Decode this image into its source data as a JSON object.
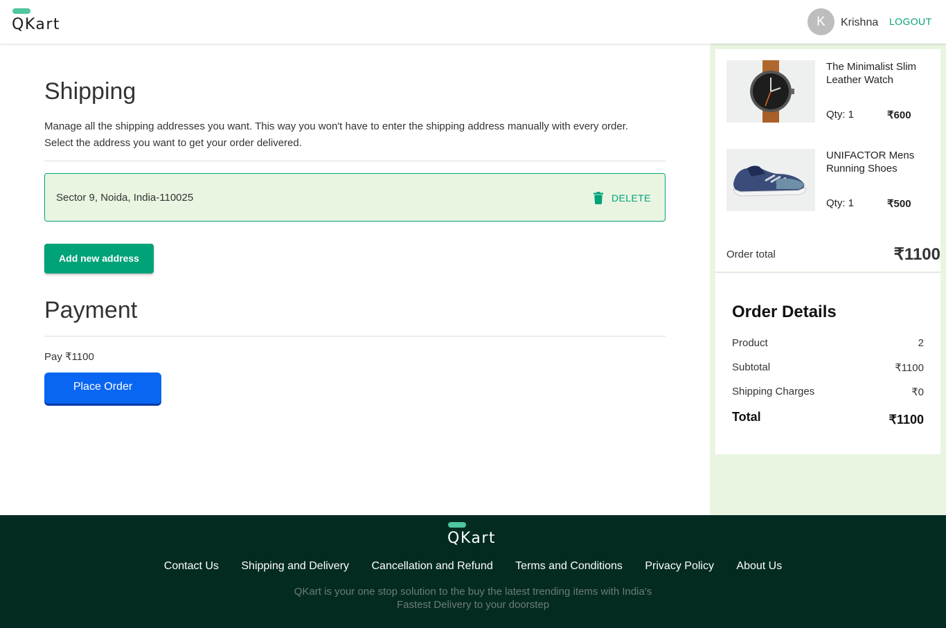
{
  "header": {
    "logo_text": "QKart",
    "avatar_letter": "K",
    "username": "Krishna",
    "logout_label": "LOGOUT"
  },
  "shipping": {
    "title": "Shipping",
    "description_line1": "Manage all the shipping addresses you want. This way you won't have to enter the shipping address manually with every order.",
    "description_line2": "Select the address you want to get your order delivered.",
    "addresses": [
      {
        "text": "Sector 9, Noida, India-110025",
        "delete_label": "DELETE",
        "icon": "trash-icon"
      }
    ],
    "add_button_label": "Add new address"
  },
  "payment": {
    "title": "Payment",
    "pay_text": "Pay ₹1100",
    "place_order_label": "Place Order"
  },
  "cart": {
    "items": [
      {
        "name": "The Minimalist Slim Leather Watch",
        "qty": "Qty: 1",
        "price": "₹600",
        "icon": "watch-image"
      },
      {
        "name": "UNIFACTOR Mens Running Shoes",
        "qty": "Qty: 1",
        "price": "₹500",
        "icon": "shoe-image"
      }
    ],
    "order_total_label": "Order total",
    "order_total_value": "₹1100"
  },
  "order_details": {
    "title": "Order Details",
    "product_label": "Product",
    "product_value": "2",
    "subtotal_label": "Subtotal",
    "subtotal_value": "₹1100",
    "shipping_label": "Shipping Charges",
    "shipping_value": "₹0",
    "total_label": "Total",
    "total_value": "₹1100"
  },
  "footer": {
    "logo_text": "QKart",
    "links": [
      "Contact Us",
      "Shipping and Delivery",
      "Cancellation and Refund",
      "Terms and Conditions",
      "Privacy Policy",
      "About Us"
    ],
    "tagline_line1": "QKart is your one stop solution to the buy the latest trending items with India's",
    "tagline_line2": "Fastest Delivery to your doorstep"
  },
  "colors": {
    "accent": "#00a278",
    "primary_button": "#0966f2",
    "sidebar_bg": "#e9f5e1",
    "footer_bg": "#032b22"
  }
}
